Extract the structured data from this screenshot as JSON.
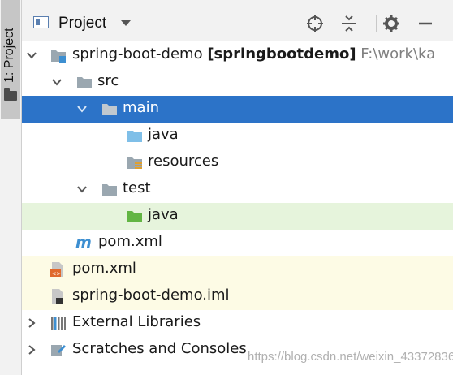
{
  "tool_strip": {
    "tab_label": "1: Project"
  },
  "header": {
    "title": "Project"
  },
  "tree": {
    "root": {
      "name": "spring-boot-demo",
      "module": "[springbootdemo]",
      "path": "F:\\work\\ka"
    },
    "src": "src",
    "main": "main",
    "main_java": "java",
    "resources": "resources",
    "test": "test",
    "test_java": "java",
    "pom_module": "pom.xml",
    "pom_root": "pom.xml",
    "iml": "spring-boot-demo.iml",
    "external_libraries": "External Libraries",
    "scratches": "Scratches and Consoles"
  },
  "watermark": "https://blog.csdn.net/weixin_43372836",
  "colors": {
    "selection": "#2c73c8",
    "test_highlight": "#e6f4dc",
    "module_highlight": "#fdfbe5",
    "folder": "#9aa7b0",
    "source_folder": "#7fbfe8",
    "test_folder": "#62b543"
  },
  "icons": [
    "project-view-icon",
    "locate-icon",
    "collapse-all-icon",
    "settings-gear-icon",
    "hide-icon",
    "maven-icon",
    "folder-icon",
    "resources-folder-icon",
    "library-icon",
    "scratches-icon"
  ]
}
